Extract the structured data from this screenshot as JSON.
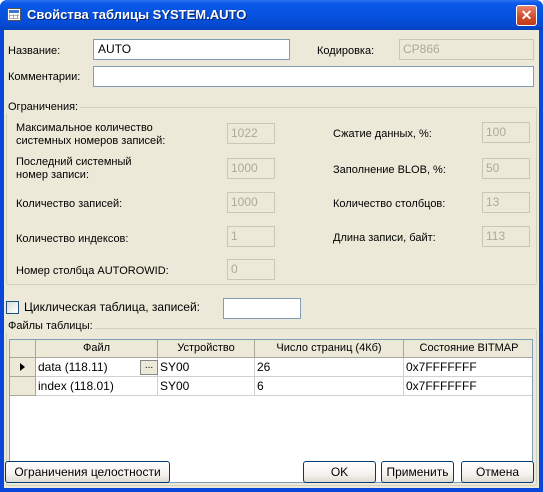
{
  "window": {
    "title": "Свойства таблицы SYSTEM.AUTO",
    "title_icon": "table-icon",
    "close_glyph": "✕"
  },
  "general": {
    "name_label": "Название:",
    "name_value": "AUTO",
    "encoding_label": "Кодировка:",
    "encoding_value": "CP866",
    "comment_label": "Комментарии:",
    "comment_value": ""
  },
  "limits": {
    "caption": "Ограничения:",
    "max_sys_records_label_1": "Максимальное количество",
    "max_sys_records_label_2": "системных номеров записей:",
    "max_sys_records_value": "1022",
    "last_sys_record_label_1": "Последний системный",
    "last_sys_record_label_2": "номер записи:",
    "last_sys_record_value": "1000",
    "record_count_label": "Количество записей:",
    "record_count_value": "1000",
    "index_count_label": "Количество индексов:",
    "index_count_value": "1",
    "autorowid_label": "Номер столбца AUTOROWID:",
    "autorowid_value": "0",
    "compression_label": "Сжатие данных, %:",
    "compression_value": "100",
    "blob_fill_label": "Заполнение BLOB, %:",
    "blob_fill_value": "50",
    "column_count_label": "Количество столбцов:",
    "column_count_value": "13",
    "record_length_label": "Длина записи, байт:",
    "record_length_value": "113"
  },
  "cyclic": {
    "label": "Циклическая таблица, записей:",
    "checked": false,
    "value": ""
  },
  "files": {
    "caption": "Файлы таблицы:",
    "columns": [
      "Файл",
      "Устройство",
      "Число страниц (4Кб)",
      "Состояние BITMAP"
    ],
    "rows": [
      {
        "file": "data (118.11)",
        "device": "SY00",
        "pages": "26",
        "bitmap": "0x7FFFFFFF"
      },
      {
        "file": "index (118.01)",
        "device": "SY00",
        "pages": "6",
        "bitmap": "0x7FFFFFFF"
      }
    ],
    "ellipsis": "..."
  },
  "buttons": {
    "integrity": "Ограничения целостности",
    "ok": "OK",
    "apply": "Применить",
    "cancel": "Отмена"
  }
}
